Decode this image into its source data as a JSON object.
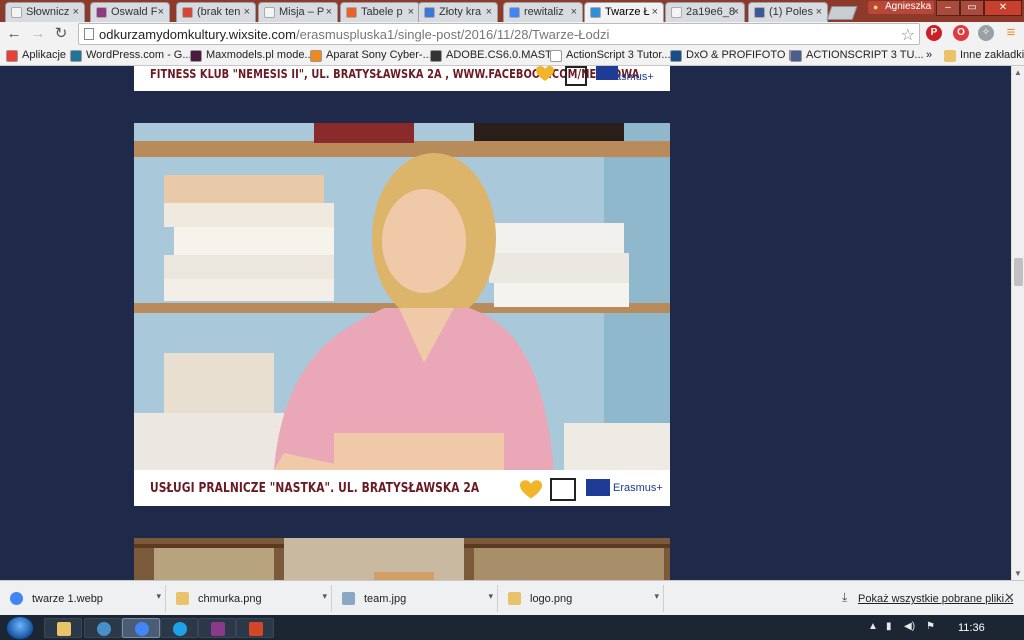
{
  "browser": {
    "tabs": [
      {
        "label": "Słownicz",
        "color": "#f4f4f4"
      },
      {
        "label": "Oswald F",
        "color": "#8e3b82"
      },
      {
        "label": "(brak ten",
        "color": "#d44638"
      },
      {
        "label": "Misja – P",
        "color": "#f4f4f4"
      },
      {
        "label": "Tabele p",
        "color": "#e8622a"
      },
      {
        "label": "Złoty kra",
        "color": "#3b79d9"
      },
      {
        "label": "rewitaliz",
        "color": "#4285f4"
      },
      {
        "label": "Twarze Ł",
        "color": "#2f8fd8"
      },
      {
        "label": "2a19e6_8",
        "color": "#f4f4f4"
      },
      {
        "label": "(1) Poles",
        "color": "#3b5998"
      }
    ],
    "profile_name": "Agnieszka",
    "window_buttons": [
      "–",
      "▭",
      "✕"
    ],
    "url_host": "odkurzamydomkultury.wixsite.com",
    "url_path": "/erasmuspluska1/single-post/2016/11/28/Twarze-Łodzi",
    "extensions": [
      {
        "icon": "pinterest-icon",
        "glyph": "P",
        "color": "#cb2027"
      },
      {
        "icon": "opera-icon",
        "glyph": "O",
        "color": "#e03a3e"
      },
      {
        "icon": "puzzle-icon",
        "glyph": "✧",
        "color": "#9aa0a6"
      },
      {
        "icon": "menu-icon",
        "glyph": "≡",
        "color": "#f0a030"
      }
    ]
  },
  "bookmarks": {
    "items": [
      {
        "label": "Aplikacje",
        "color": "#e94235"
      },
      {
        "label": "WordPress.com - G...",
        "color": "#21759b"
      },
      {
        "label": "Maxmodels.pl mode...",
        "color": "#4a1a3a"
      },
      {
        "label": "Aparat Sony Cyber-...",
        "color": "#f08a1c"
      },
      {
        "label": "ADOBE.CS6.0.MAST...",
        "color": "#333333"
      },
      {
        "label": "ActionScript 3 Tutor...",
        "color": "#ffffff"
      },
      {
        "label": "DxO & PROFIFOTO |...",
        "color": "#1a4d8c"
      },
      {
        "label": "ACTIONSCRIPT 3 TU...",
        "color": "#4a5d8c"
      }
    ],
    "more": "»",
    "other_label": "Inne zakładki"
  },
  "page": {
    "card1_caption": "FITNESS KLUB \"NEMESIS II\", UL. BRATYSŁAWSKA 2A , WWW.FACEBOOK.COM/NEMEDWA",
    "card2_caption": "USŁUGI PRALNICZE \"NASTKA\". UL. BRATYSŁAWSKA 2A",
    "erasmus_label": "Erasmus+"
  },
  "downloads": {
    "items": [
      {
        "name": "twarze 1.webp",
        "icon": "chrome-icon"
      },
      {
        "name": "chmurka.png",
        "icon": "image-icon"
      },
      {
        "name": "team.jpg",
        "icon": "image-icon"
      },
      {
        "name": "logo.png",
        "icon": "image-icon"
      }
    ],
    "show_all": "Pokaż wszystkie pobrane pliki..."
  },
  "taskbar": {
    "clock": "11:36",
    "apps": [
      {
        "name": "explorer",
        "color": "#e8c36a"
      },
      {
        "name": "globe",
        "color": "#4a90c8"
      },
      {
        "name": "chrome",
        "color": "#4285f4"
      },
      {
        "name": "ie",
        "color": "#1ea1e8"
      },
      {
        "name": "winrar",
        "color": "#8a3a8a"
      },
      {
        "name": "powerpoint",
        "color": "#d24726"
      }
    ]
  }
}
